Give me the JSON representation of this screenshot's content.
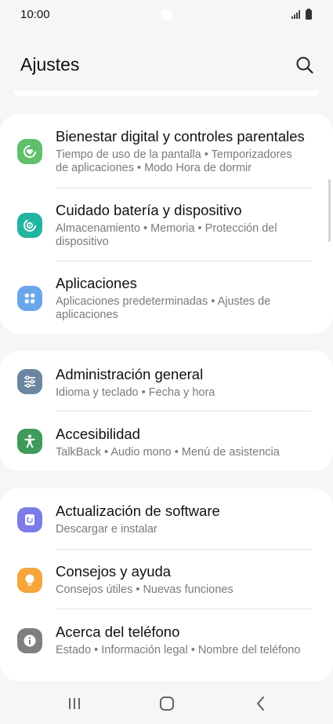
{
  "status_bar": {
    "time": "10:00"
  },
  "header": {
    "title": "Ajustes",
    "search_icon": "search-icon"
  },
  "groups": [
    {
      "items": [
        {
          "title": "Bienestar digital y controles parentales",
          "subtitle": "Tiempo de uso de la pantalla  •  Temporizadores de aplicaciones  •  Modo Hora de dormir",
          "icon": "digital-wellbeing-icon",
          "color": "#5fbf6b"
        },
        {
          "title": "Cuidado batería y dispositivo",
          "subtitle": "Almacenamiento  •  Memoria  •  Protección del dispositivo",
          "icon": "device-care-icon",
          "color": "#20b5a1"
        },
        {
          "title": "Aplicaciones",
          "subtitle": "Aplicaciones predeterminadas  •  Ajustes de aplicaciones",
          "icon": "apps-icon",
          "color": "#6aa6ea"
        }
      ]
    },
    {
      "items": [
        {
          "title": "Administración general",
          "subtitle": "Idioma y teclado  •  Fecha y hora",
          "icon": "sliders-icon",
          "color": "#6b86a0"
        },
        {
          "title": "Accesibilidad",
          "subtitle": "TalkBack  •  Audio mono  •  Menú de asistencia",
          "icon": "accessibility-icon",
          "color": "#3f9a5b"
        }
      ]
    },
    {
      "items": [
        {
          "title": "Actualización de software",
          "subtitle": "Descargar e instalar",
          "icon": "software-update-icon",
          "color": "#7b7be8"
        },
        {
          "title": "Consejos y ayuda",
          "subtitle": "Consejos útiles  •  Nuevas funciones",
          "icon": "lightbulb-icon",
          "color": "#f5a53a"
        },
        {
          "title": "Acerca del teléfono",
          "subtitle": "Estado  •  Información legal  •  Nombre del teléfono",
          "icon": "info-icon",
          "color": "#7f7f7f"
        }
      ]
    }
  ],
  "nav_bar": {
    "recents": "recents-icon",
    "home": "home-icon",
    "back": "back-icon"
  }
}
